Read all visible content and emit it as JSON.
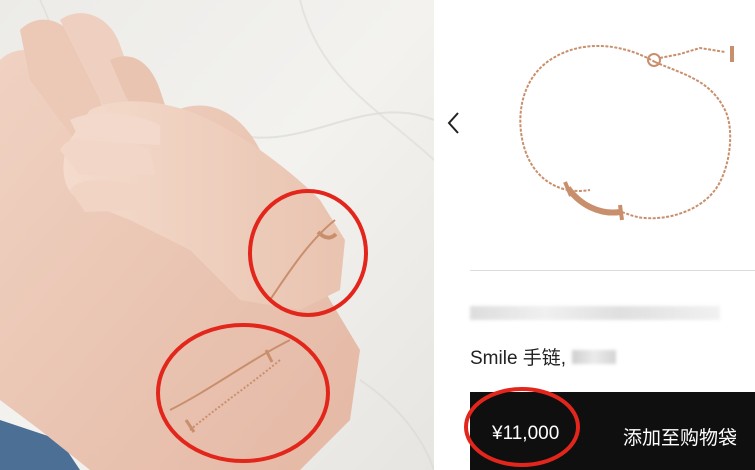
{
  "product": {
    "name": "Smile 手链,",
    "price": "¥11,000",
    "add_to_bag_label": "添加至购物袋"
  },
  "icons": {
    "prev": "chevron-left-icon"
  },
  "colors": {
    "bag_bar": "#0f0f0f",
    "highlight_circle": "#e3261c",
    "rose_gold": "#c98f6c"
  }
}
